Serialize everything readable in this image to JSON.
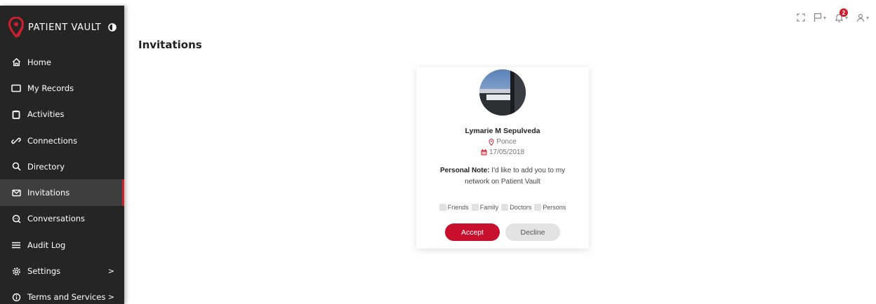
{
  "brand": {
    "name": "PATIENT VAULT"
  },
  "sidebar": {
    "items": [
      {
        "label": "Home",
        "icon": "home-icon"
      },
      {
        "label": "My Records",
        "icon": "folder-icon"
      },
      {
        "label": "Activities",
        "icon": "clipboard-icon"
      },
      {
        "label": "Connections",
        "icon": "link-icon"
      },
      {
        "label": "Directory",
        "icon": "search-icon"
      },
      {
        "label": "Invitations",
        "icon": "envelope-icon",
        "active": true
      },
      {
        "label": "Conversations",
        "icon": "chat-icon"
      },
      {
        "label": "Audit Log",
        "icon": "list-icon"
      },
      {
        "label": "Settings",
        "icon": "gear-icon",
        "chevron": ">"
      },
      {
        "label": "Terms and Services",
        "icon": "info-icon",
        "chevron": ">"
      }
    ]
  },
  "header": {
    "page_title": "Invitations",
    "notification_count": "2"
  },
  "invitation": {
    "name": "Lymarie M Sepulveda",
    "location": "Ponce",
    "date": "17/05/2018",
    "note_label": "Personal Note:",
    "note_text": " I'd like to add you to my network on Patient Vault",
    "groups": [
      "Friends",
      "Family",
      "Doctors",
      "Persons"
    ],
    "accept_label": "Accept",
    "decline_label": "Decline"
  },
  "colors": {
    "accent": "#c8102e",
    "sidebar_bg": "#252525",
    "sidebar_active": "#3e3e3e"
  }
}
